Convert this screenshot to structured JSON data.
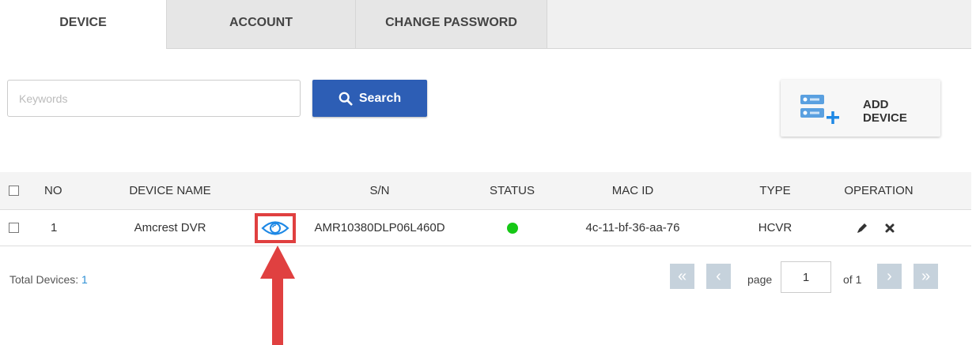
{
  "tabs": [
    {
      "label": "DEVICE",
      "active": true
    },
    {
      "label": "ACCOUNT",
      "active": false
    },
    {
      "label": "CHANGE PASSWORD",
      "active": false
    }
  ],
  "search": {
    "placeholder": "Keywords",
    "value": "",
    "button_label": "Search",
    "icon": "search-icon"
  },
  "add_device": {
    "label_line1": "ADD",
    "label_line2": "DEVICE",
    "icon": "add-device-icon"
  },
  "table": {
    "columns": [
      "NO",
      "DEVICE NAME",
      "S/N",
      "STATUS",
      "MAC ID",
      "TYPE",
      "OPERATION"
    ],
    "rows": [
      {
        "no": "1",
        "device_name": "Amcrest DVR",
        "sn": "AMR10380DLP06L460D",
        "status": "online",
        "mac_id": "4c-11-bf-36-aa-76",
        "type": "HCVR"
      }
    ]
  },
  "footer": {
    "total_label": "Total Devices:",
    "total_value": "1",
    "page_label": "page",
    "page_value": "1",
    "of_label": "of 1"
  },
  "colors": {
    "accent": "#2d5eb5",
    "status_online": "#16c816",
    "annotation": "#e04040",
    "link": "#2d8fd5"
  }
}
